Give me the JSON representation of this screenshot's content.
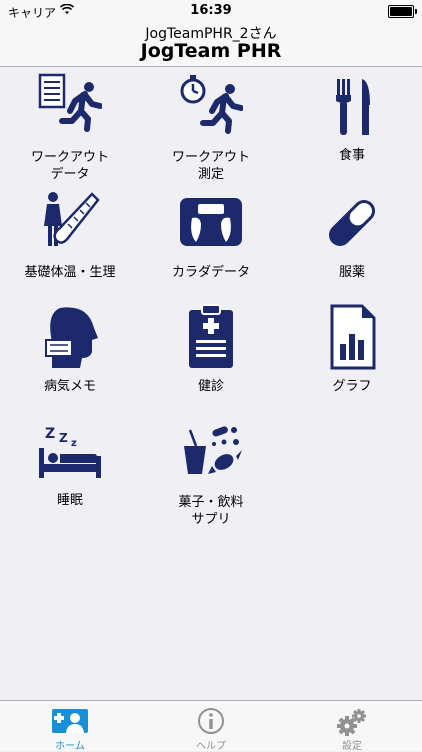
{
  "status": {
    "carrier": "キャリア",
    "time": "16:39"
  },
  "nav": {
    "subtitle": "JogTeamPHR_2さん",
    "title": "JogTeam PHR"
  },
  "menu": [
    {
      "label1": "ワークアウト",
      "label2": "データ",
      "icon": "workout-data-icon"
    },
    {
      "label1": "ワークアウト",
      "label2": "測定",
      "icon": "workout-measure-icon"
    },
    {
      "label1": "食事",
      "label2": "",
      "icon": "meal-icon"
    },
    {
      "label1": "基礎体温・生理",
      "label2": "",
      "icon": "basal-temperature-icon"
    },
    {
      "label1": "カラダデータ",
      "label2": "",
      "icon": "body-data-icon"
    },
    {
      "label1": "服薬",
      "label2": "",
      "icon": "medication-icon"
    },
    {
      "label1": "病気メモ",
      "label2": "",
      "icon": "illness-memo-icon"
    },
    {
      "label1": "健診",
      "label2": "",
      "icon": "checkup-icon"
    },
    {
      "label1": "グラフ",
      "label2": "",
      "icon": "graph-icon"
    },
    {
      "label1": "睡眠",
      "label2": "",
      "icon": "sleep-icon"
    },
    {
      "label1": "菓子・飲料",
      "label2": "サプリ",
      "icon": "snack-drink-icon"
    }
  ],
  "tabs": [
    {
      "label": "ホーム",
      "icon": "home-icon",
      "active": true
    },
    {
      "label": "ヘルプ",
      "icon": "help-icon",
      "active": false
    },
    {
      "label": "設定",
      "icon": "settings-icon",
      "active": false
    }
  ],
  "colors": {
    "icon": "#1c2a6b",
    "tab_active": "#1a8fd6",
    "tab_inactive": "#929292"
  }
}
